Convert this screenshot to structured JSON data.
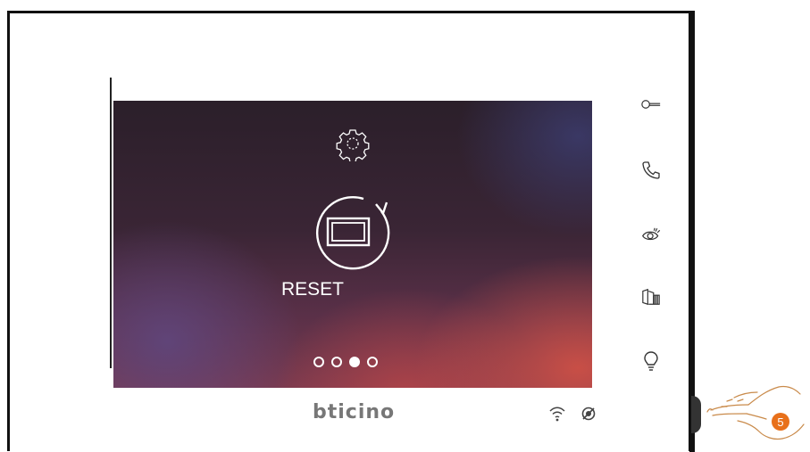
{
  "screen": {
    "title_icon": "gear-icon",
    "reset_label": "RESET",
    "pagination": {
      "total": 4,
      "active_index": 2
    }
  },
  "side_buttons": [
    {
      "name": "key-icon"
    },
    {
      "name": "phone-icon"
    },
    {
      "name": "eye-icon"
    },
    {
      "name": "door-building-icon"
    },
    {
      "name": "lightbulb-icon"
    }
  ],
  "footer": {
    "brand": "bticino",
    "status_icons": [
      "wifi-icon",
      "mute-icon"
    ]
  },
  "callout": {
    "step_number": "5",
    "accent": "#e8701a"
  }
}
